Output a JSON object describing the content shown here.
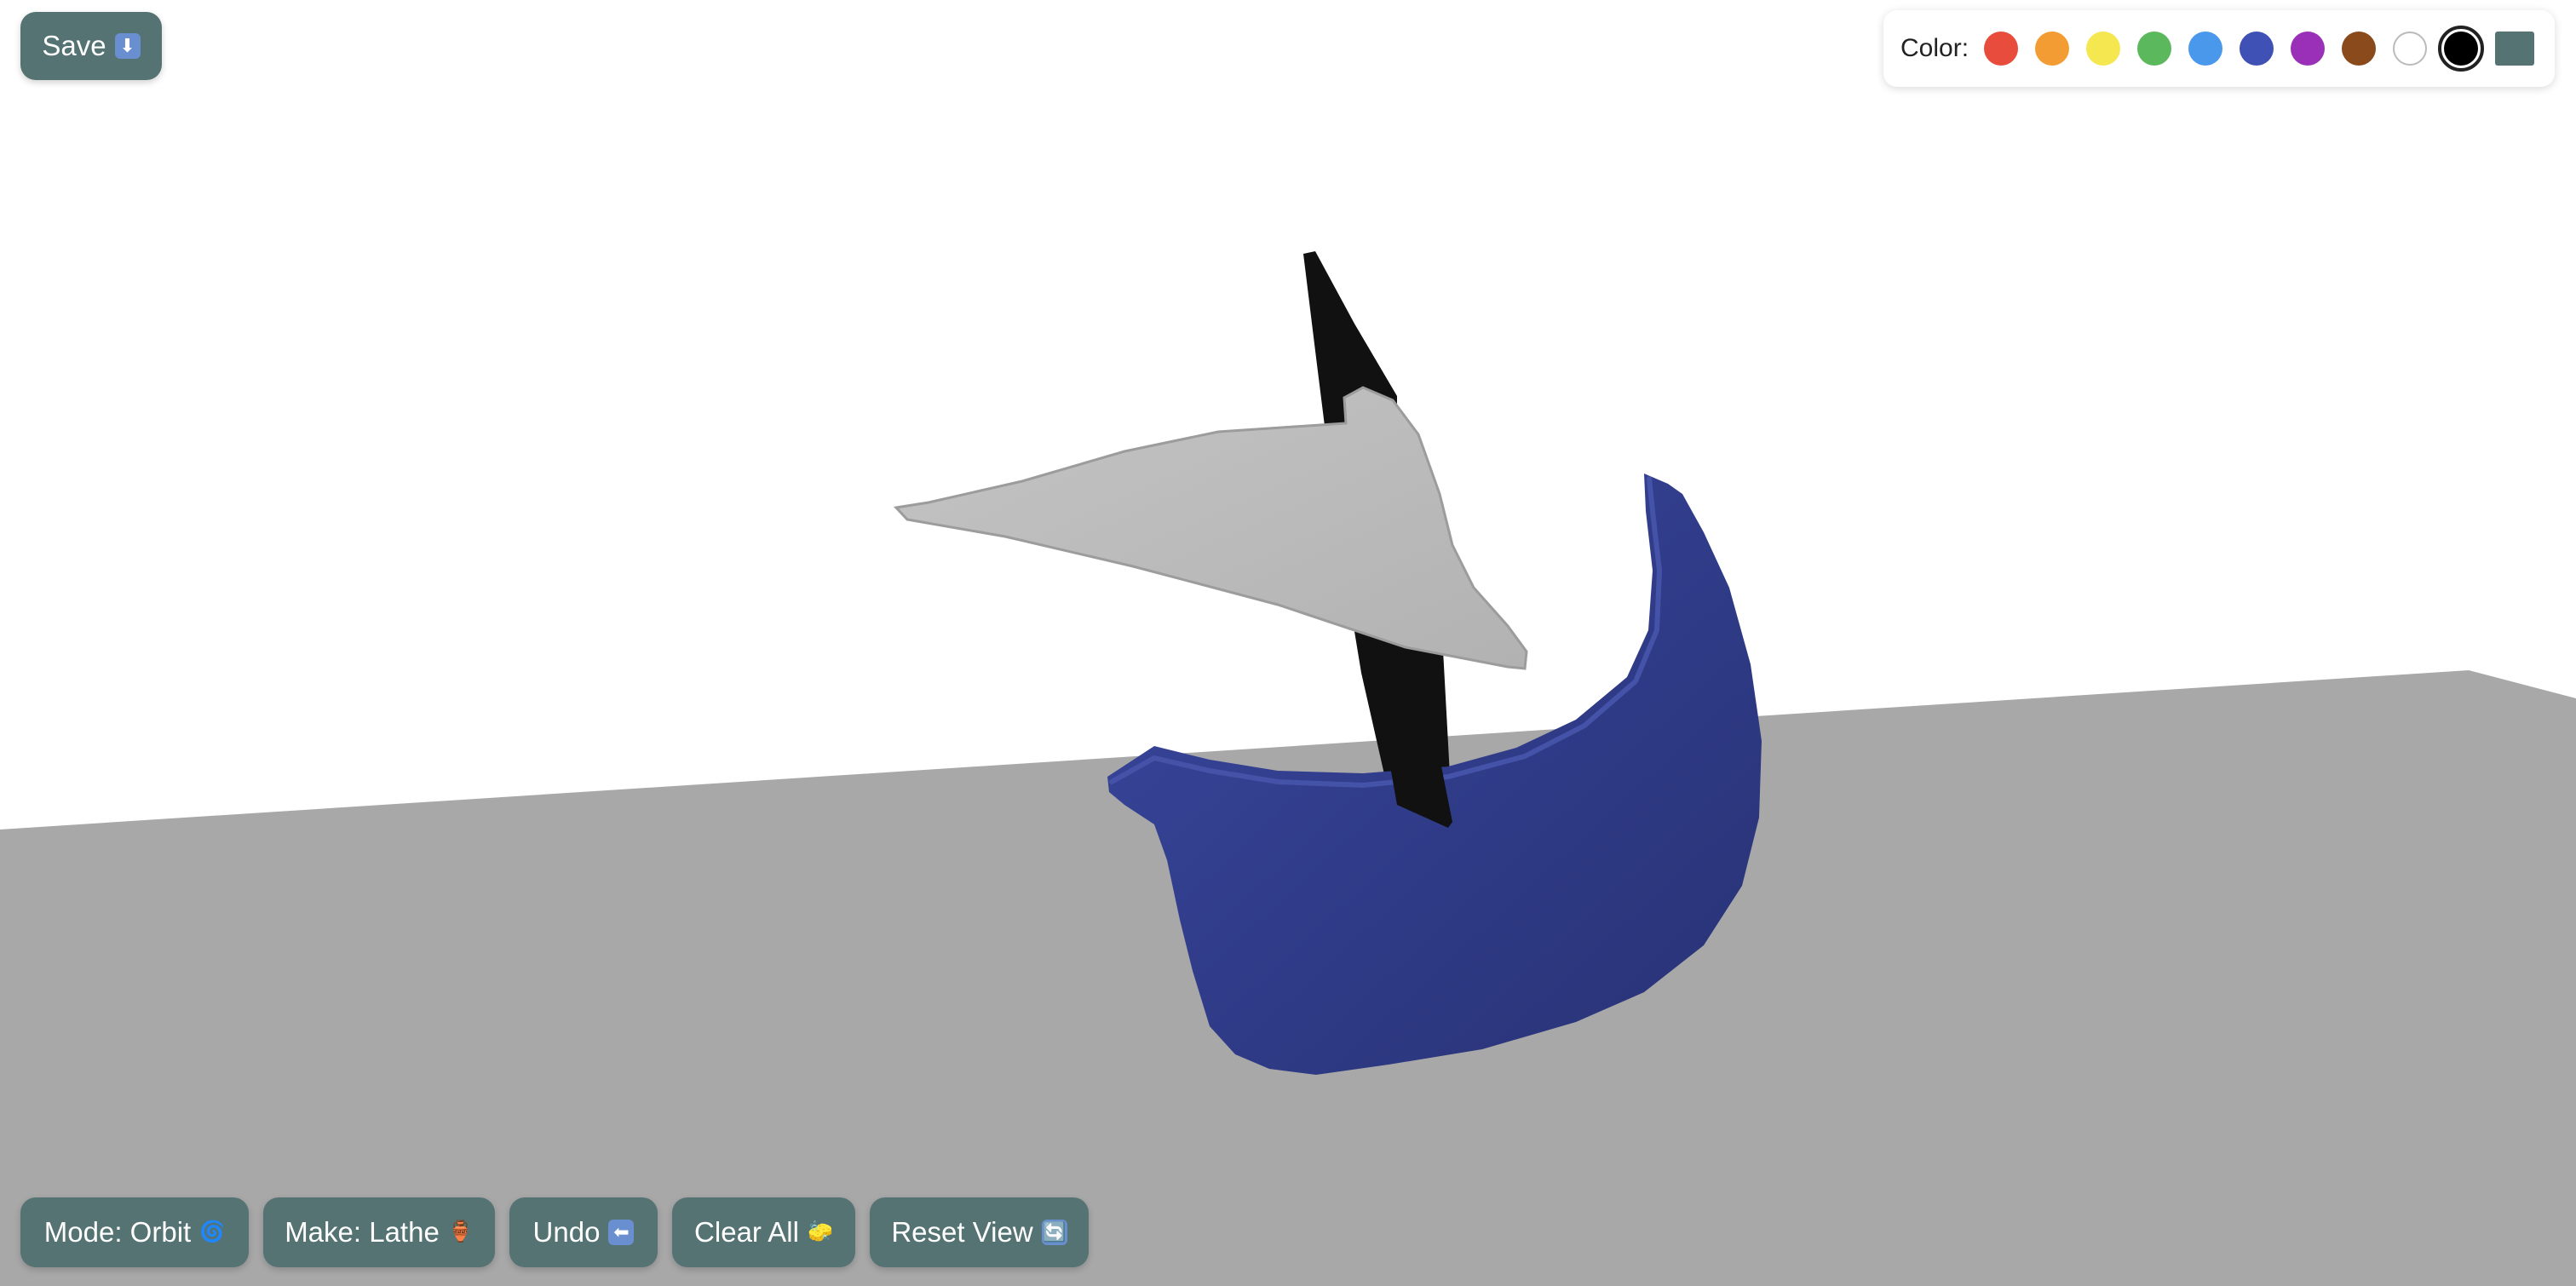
{
  "toolbar": {
    "save_label": "Save",
    "save_icon": "⬇",
    "mode_label": "Mode: Orbit",
    "mode_icon": "🌀",
    "make_label": "Make: Lathe",
    "make_icon": "🏺",
    "undo_label": "Undo",
    "undo_icon": "⬅",
    "clear_label": "Clear All",
    "clear_icon": "🧽",
    "reset_label": "Reset View",
    "reset_icon": "🔄"
  },
  "palette": {
    "label": "Color:",
    "swatches": [
      {
        "name": "red",
        "color": "#e74c3c"
      },
      {
        "name": "orange",
        "color": "#f39c34"
      },
      {
        "name": "yellow",
        "color": "#f5e74f"
      },
      {
        "name": "green",
        "color": "#5cb85c"
      },
      {
        "name": "blue",
        "color": "#4a98ec"
      },
      {
        "name": "indigo",
        "color": "#3f51b5"
      },
      {
        "name": "purple",
        "color": "#9b30b8"
      },
      {
        "name": "brown",
        "color": "#8b4a1c"
      },
      {
        "name": "white",
        "color": "#ffffff"
      },
      {
        "name": "black",
        "color": "#000000",
        "selected": true
      },
      {
        "name": "slate",
        "color": "#557373"
      }
    ]
  },
  "scene": {
    "background_color": "#ffffff",
    "ground_color": "#a8a8a8",
    "hull_color": "#2e3a85",
    "mast_color": "#111111",
    "sail_color": "#bababa"
  }
}
